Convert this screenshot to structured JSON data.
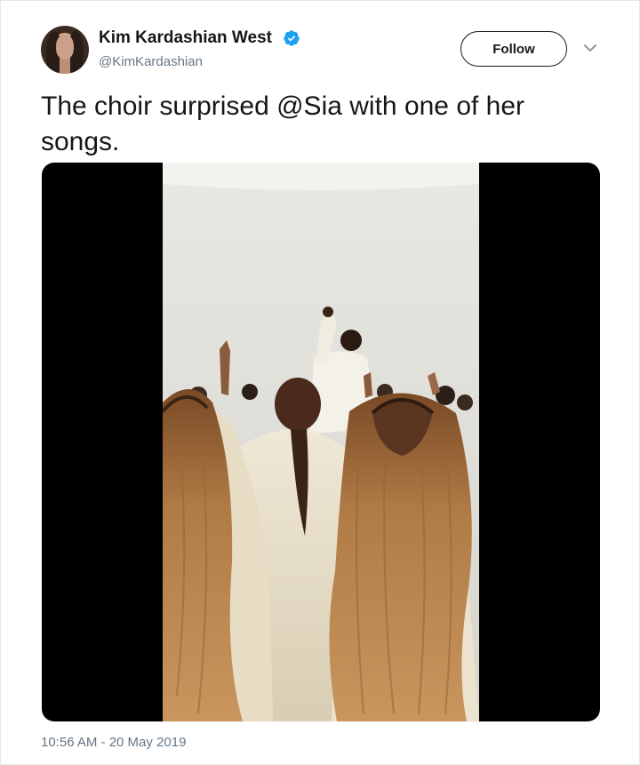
{
  "tweet": {
    "author_name": "Kim Kardashian West",
    "author_handle": "@KimKardashian",
    "verified": true,
    "follow_label": "Follow",
    "text": "The choir surprised @Sia with one of her songs.",
    "timestamp": "10:56 AM - 20 May 2019"
  },
  "icons": {
    "verified": "verified-badge-icon",
    "menu": "chevron-down-icon"
  },
  "colors": {
    "verified_blue": "#1da1f2",
    "secondary_text": "#657786",
    "primary_text": "#14171a"
  }
}
